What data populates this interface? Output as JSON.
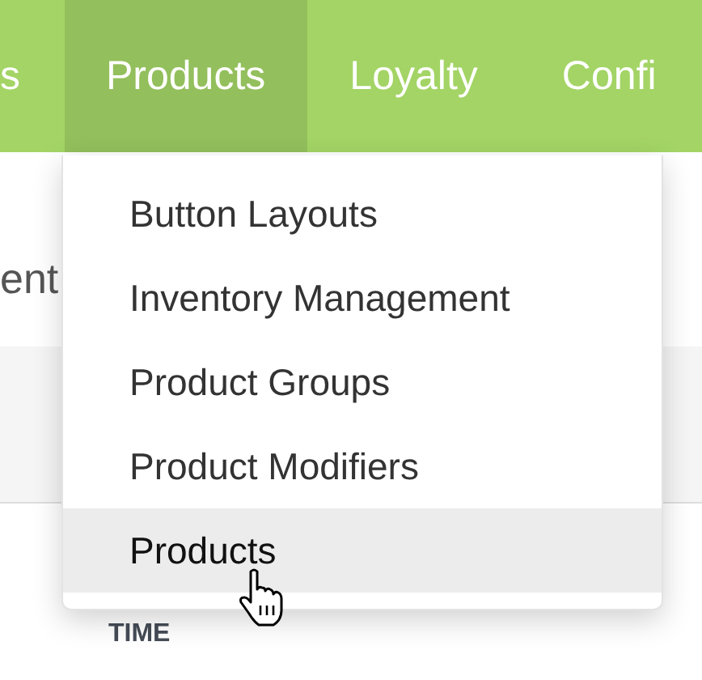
{
  "nav": {
    "tabs": [
      {
        "label": "s",
        "selected": false
      },
      {
        "label": "Products",
        "selected": true
      },
      {
        "label": "Loyalty",
        "selected": false
      },
      {
        "label": "Confi",
        "selected": false
      }
    ]
  },
  "page": {
    "heading": "ent",
    "column_header": "TIME"
  },
  "dropdown": {
    "items": [
      {
        "label": "Button Layouts",
        "highlighted": false
      },
      {
        "label": "Inventory Management",
        "highlighted": false
      },
      {
        "label": "Product Groups",
        "highlighted": false
      },
      {
        "label": "Product Modifiers",
        "highlighted": false
      },
      {
        "label": "Products",
        "highlighted": true
      }
    ]
  }
}
